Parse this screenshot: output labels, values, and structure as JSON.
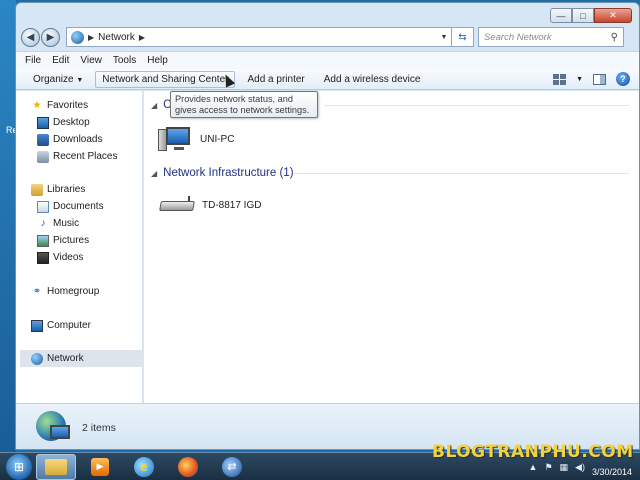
{
  "desktop": {
    "edge_label": "Re"
  },
  "window": {
    "caption_buttons": {
      "minimize": "—",
      "maximize": "□",
      "close": "✕"
    },
    "address": {
      "crumb": "Network",
      "search_placeholder": "Search Network"
    },
    "menubar": [
      "File",
      "Edit",
      "View",
      "Tools",
      "Help"
    ],
    "toolbar": {
      "organize": "Organize",
      "network_sharing": "Network and Sharing Center",
      "add_printer": "Add a printer",
      "add_wireless": "Add a wireless device"
    },
    "tooltip": "Provides network status, and gives access to network settings.",
    "navigation": {
      "favorites": "Favorites",
      "desktop": "Desktop",
      "downloads": "Downloads",
      "recent_places": "Recent Places",
      "libraries": "Libraries",
      "documents": "Documents",
      "music": "Music",
      "pictures": "Pictures",
      "videos": "Videos",
      "homegroup": "Homegroup",
      "computer": "Computer",
      "network": "Network"
    },
    "content": {
      "group1_header": "C",
      "item_pc": "UNI-PC",
      "group2_header": "Network Infrastructure (1)",
      "item_router": "TD-8817 IGD"
    },
    "details": {
      "count": "2 items"
    }
  },
  "taskbar": {
    "clock_date": "3/30/2014"
  },
  "watermark": "BLOGTRANPHU.COM"
}
